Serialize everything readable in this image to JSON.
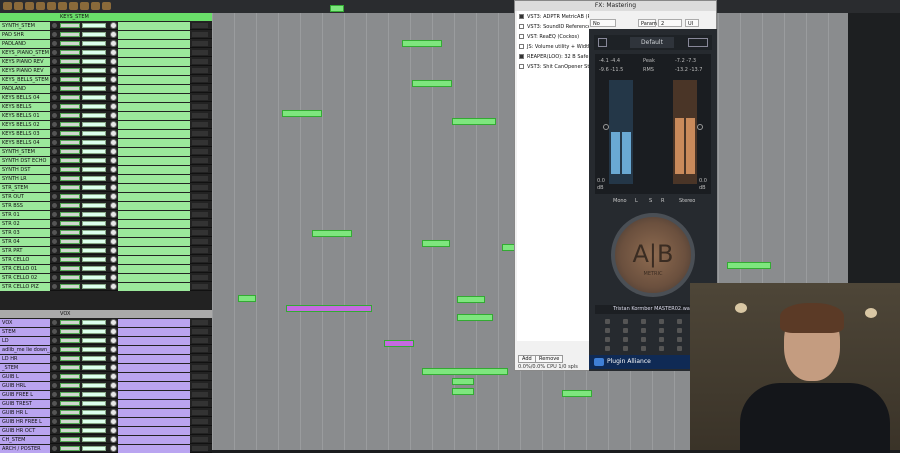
{
  "tracks": [
    {
      "name": "SYNTH_STEM",
      "color": "#9be89b"
    },
    {
      "name": "PAD SHR",
      "color": "#9be89b"
    },
    {
      "name": "PADLAND",
      "color": "#9be89b"
    },
    {
      "name": "KEYS_PIANO_STEM",
      "color": "#9be89b"
    },
    {
      "name": "KEYS PIANO REV",
      "color": "#9be89b"
    },
    {
      "name": "KEYS PIANO REV",
      "color": "#9be89b"
    },
    {
      "name": "KEYS_BELLS_STEM",
      "color": "#9be89b"
    },
    {
      "name": "PADLAND",
      "color": "#9be89b"
    },
    {
      "name": "KEYS BELLS 04",
      "color": "#9be89b"
    },
    {
      "name": "KEYS BELLS",
      "color": "#9be89b"
    },
    {
      "name": "KEYS BELLS 01",
      "color": "#9be89b"
    },
    {
      "name": "KEYS BELLS 02",
      "color": "#9be89b"
    },
    {
      "name": "KEYS BELLS 03",
      "color": "#9be89b"
    },
    {
      "name": "KEYS BELLS 04",
      "color": "#9be89b"
    },
    {
      "name": "SYNTH_STEM",
      "color": "#9be89b"
    },
    {
      "name": "SYNTH DST ECHO",
      "color": "#9be89b"
    },
    {
      "name": "SYNTH DST",
      "color": "#9be89b"
    },
    {
      "name": "SYNTH LR",
      "color": "#9be89b"
    },
    {
      "name": "STR_STEM",
      "color": "#9be89b"
    },
    {
      "name": "STR OUT",
      "color": "#9be89b"
    },
    {
      "name": "STR BSS",
      "color": "#9be89b"
    },
    {
      "name": "STR 01",
      "color": "#9be89b"
    },
    {
      "name": "STR 02",
      "color": "#9be89b"
    },
    {
      "name": "STR 03",
      "color": "#9be89b"
    },
    {
      "name": "STR 04",
      "color": "#9be89b"
    },
    {
      "name": "STR PRT",
      "color": "#9be89b"
    },
    {
      "name": "STR CELLO",
      "color": "#9be89b"
    },
    {
      "name": "STR CELLO 01",
      "color": "#9be89b"
    },
    {
      "name": "STR CELLO 02",
      "color": "#9be89b"
    },
    {
      "name": "STR CELLO PIZ",
      "color": "#9be89b"
    },
    {
      "name": "VOX",
      "color": "#b9a4f0"
    },
    {
      "name": "STEM",
      "color": "#b9a4f0"
    },
    {
      "name": "LD",
      "color": "#b9a4f0"
    },
    {
      "name": "adlib_me lie down_subtrafo",
      "color": "#b9a4f0"
    },
    {
      "name": "LD HR",
      "color": "#b9a4f0"
    },
    {
      "name": "_STEM",
      "color": "#b9a4f0"
    },
    {
      "name": "GUIB L",
      "color": "#b9a4f0"
    },
    {
      "name": "GUIB HRL",
      "color": "#b9a4f0"
    },
    {
      "name": "GUIB FREE L",
      "color": "#b9a4f0"
    },
    {
      "name": "GUIB TREST",
      "color": "#b9a4f0"
    },
    {
      "name": "GUIB HR L",
      "color": "#b9a4f0"
    },
    {
      "name": "GUIB HR FREE L",
      "color": "#b9a4f0"
    },
    {
      "name": "GUIB HR OCT",
      "color": "#b9a4f0"
    },
    {
      "name": "CH_STEM",
      "color": "#b9a4f0"
    },
    {
      "name": "ARCH / POSTER",
      "color": "#b9a4f0"
    }
  ],
  "folder_header": {
    "name": "KEYS_STEM"
  },
  "folder_header_2": {
    "name": "VOX"
  },
  "fx_window": {
    "title": "FX: Mastering",
    "items": [
      {
        "label": "VST3: ADPTR MetricAB (P",
        "checked": true
      },
      {
        "label": "VST3: SoundID Reference (",
        "checked": false
      },
      {
        "label": "VST: ReaEQ (Cockos)",
        "checked": false
      },
      {
        "label": "JS: Volume utility + Width (",
        "checked": false
      },
      {
        "label": "REAPER(LOO): 32 B Safe A",
        "checked": true
      },
      {
        "label": "VST3: Shit CanOpener Stu",
        "checked": false
      }
    ],
    "preset_bar": {
      "no_preset": "No preset",
      "param": "Param",
      "io": "2 in/out",
      "ui": "UI"
    },
    "add_button": "Add",
    "remove_button": "Remove",
    "cpu_text": "0.0%/0.0% CPU 1/0 spls"
  },
  "plugin": {
    "preset_name": "Default",
    "left_peak": "-4.1  -4.4",
    "left_rms": "-9.6  -11.5",
    "right_peak": "-7.2  -7.3",
    "right_rms": "-13.2  -13.7",
    "peak_label": "Peak",
    "rms_label": "RMS",
    "left_readout": "0.0",
    "left_readout_unit": "dB",
    "right_readout": "0.0",
    "right_readout_unit": "dB",
    "left_fill": 0.45,
    "right_fill": 0.6,
    "ctrl_labels": [
      "Mono",
      "L",
      "S",
      "R",
      "Stereo"
    ],
    "ab_text": "A|B",
    "ab_sub": "METRIC",
    "file_name": "Tristan Kormber MASTER02.wav",
    "grid_numbers": [
      "1",
      "2",
      "3",
      "4"
    ],
    "brand": "Plugin Alliance"
  },
  "colors": {
    "green_track": "#9be89b",
    "purple_track": "#b9a4f0",
    "green_clip": "#7ee67e",
    "purple_clip": "#c46be0",
    "ab_face": "#8e6b50"
  }
}
